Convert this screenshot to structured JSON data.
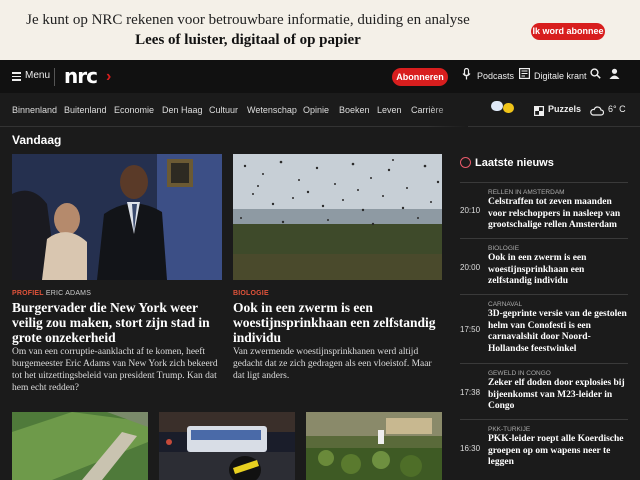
{
  "promo": {
    "line1": "Je kunt op NRC rekenen voor betrouwbare informatie, duiding en analyse",
    "line2": "Lees of luister, digitaal of op papier",
    "cta": "Ik word abonnee"
  },
  "header": {
    "menu_label": "Menu",
    "logo": "nrc",
    "subscribe": "Abonneren",
    "podcasts": "Podcasts",
    "digital": "Digitale krant"
  },
  "nav": {
    "items": [
      "Binnenland",
      "Buitenland",
      "Economie",
      "Den Haag",
      "Cultuur",
      "Wetenschap",
      "Opinie",
      "Boeken",
      "Leven",
      "Carrière"
    ],
    "puzzles": "Puzzels",
    "temperature": "6° C"
  },
  "section_title": "Vandaag",
  "articles": [
    {
      "kicker_tag": "PROFIEL",
      "kicker_name": "ERIC ADAMS",
      "headline": "Burgervader die New York weer veilig zou maken, stort zijn stad in grote onzekerheid",
      "lead": "Om van een corruptie-aanklacht af te komen, heeft burgemeester Eric Adams van New York zich bekeerd tot het uitzettingsbeleid van president Trump. Kan dat hem echt redden?"
    },
    {
      "kicker_tag": "BIOLOGIE",
      "kicker_name": "",
      "headline": "Ook in een zwerm is een woestijnsprinkhaan een zelfstandig individu",
      "lead": "Van zwermende woestijnsprinkhanen werd altijd gedacht dat ze zich gedragen als een vloeistof. Maar dat ligt anders."
    }
  ],
  "latest": {
    "title": "Laatste nieuws",
    "items": [
      {
        "time": "20:10",
        "kicker": "RELLEN IN AMSTERDAM",
        "title": "Celstraffen tot zeven maanden voor relschoppers in nasleep van grootschalige rellen Amsterdam"
      },
      {
        "time": "20:00",
        "kicker": "BIOLOGIE",
        "title": "Ook in een zwerm is een woestijnsprinkhaan een zelfstandig individu"
      },
      {
        "time": "17:50",
        "kicker": "CARNAVAL",
        "title": "3D-geprinte versie van de gestolen helm van Conofesti is een carnavalshit door Noord-Hollandse feestwinkel"
      },
      {
        "time": "17:38",
        "kicker": "GEWELD IN CONGO",
        "title": "Zeker elf doden door explosies bij bijeenkomst van M23-leider in Congo"
      },
      {
        "time": "16:30",
        "kicker": "PKK-TURKIJE",
        "title": "PKK-leider roept alle Koerdische groepen op om wapens neer te leggen"
      }
    ]
  },
  "colors": {
    "brand_red": "#d81e1e",
    "background": "#1b1b1b",
    "kicker": "#e0533a"
  }
}
